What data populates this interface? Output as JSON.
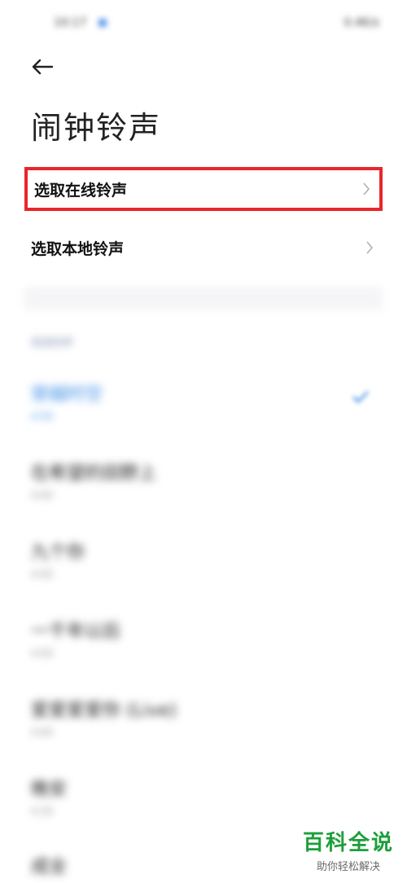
{
  "status": {
    "time": "10:17",
    "right": "0.4K/s"
  },
  "header": {
    "title": "闹钟铃声"
  },
  "options": [
    {
      "label": "选取在线铃声"
    },
    {
      "label": "选取本地铃声"
    }
  ],
  "section_label": "系统铃声",
  "songs": [
    {
      "name": "穿越时空",
      "sub": "4:50",
      "selected": true
    },
    {
      "name": "在希望的田野上",
      "sub": "4:00"
    },
    {
      "name": "九个你",
      "sub": "4:00"
    },
    {
      "name": "一千年以后",
      "sub": "4:00"
    },
    {
      "name": "爱爱爱爱你 (Live)",
      "sub": "4:00"
    },
    {
      "name": "晚安",
      "sub": "4:30"
    },
    {
      "name": "成全",
      "sub": ""
    }
  ],
  "watermark": {
    "main": "百科全说",
    "sub": "助你轻松解决"
  },
  "colors": {
    "highlight_border": "#e8262b",
    "selected_text": "#3a8de6",
    "watermark_green": "#1c9f3a"
  }
}
